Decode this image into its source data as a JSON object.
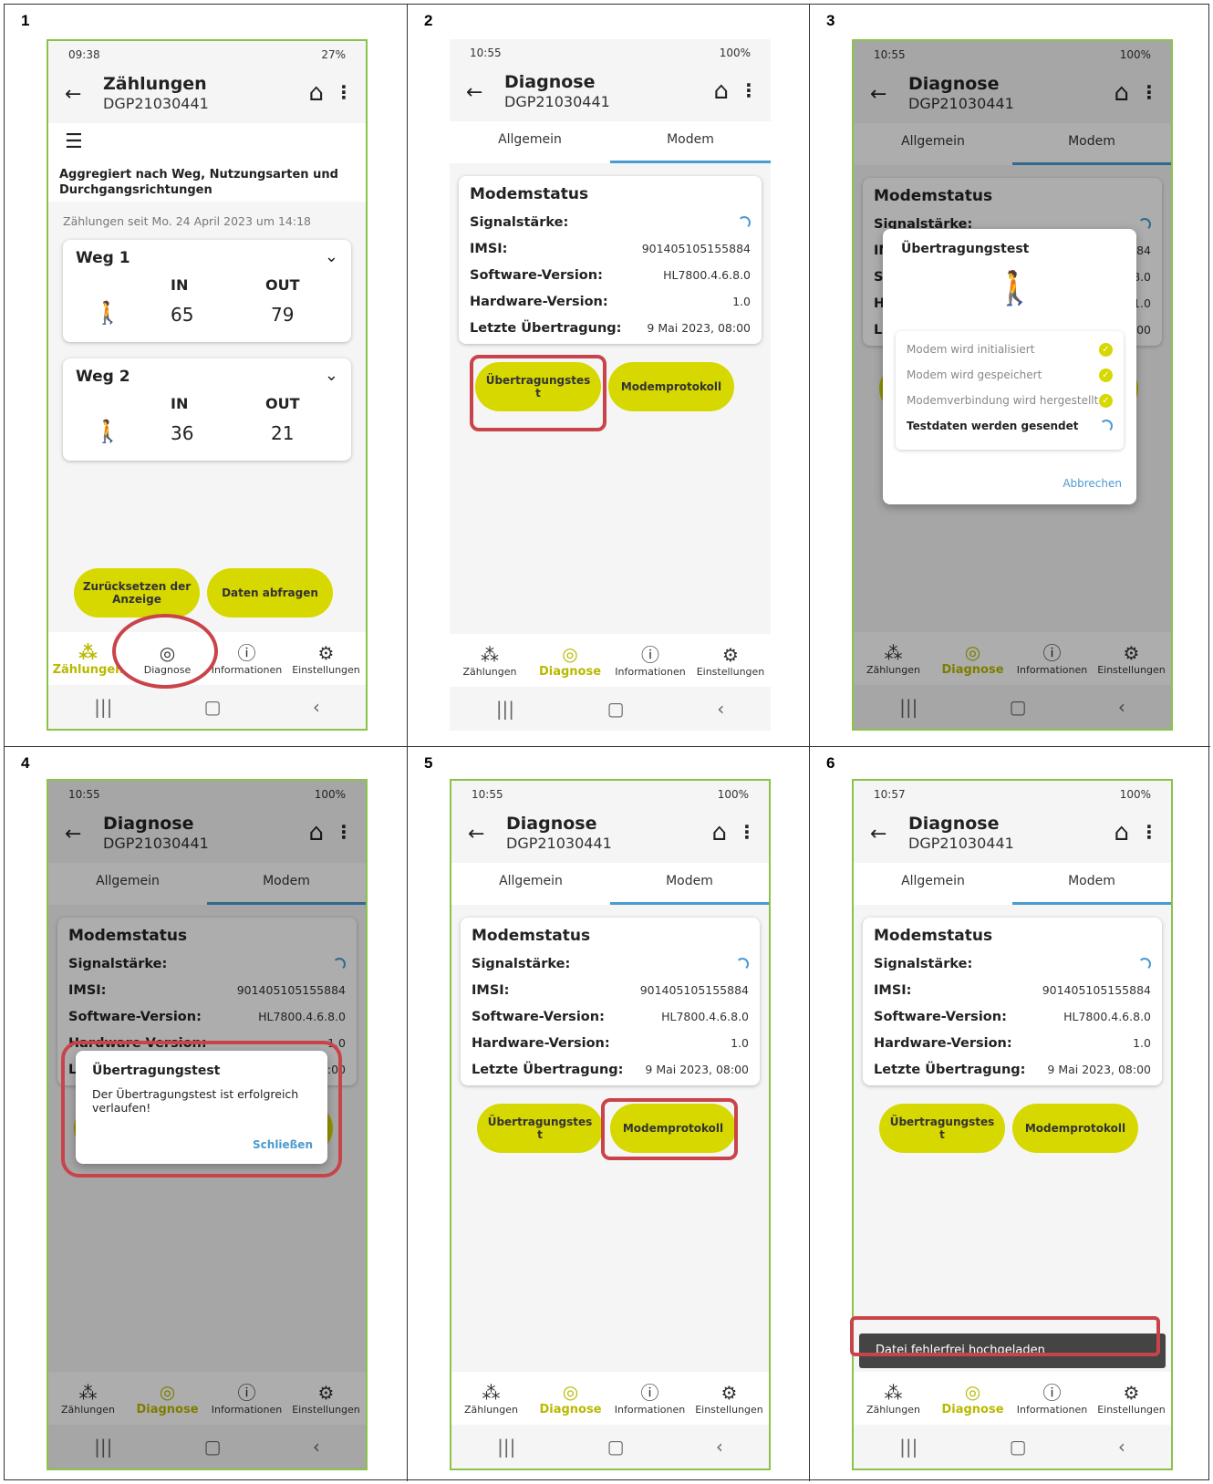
{
  "panels": [
    {
      "number": "1",
      "time": "09:38",
      "status_right": "27%",
      "title": "Zählungen",
      "serial": "DGP21030441",
      "aggregation": "Aggregiert nach Weg, Nutzungsarten und Durchgangsrichtungen",
      "since": "Zählungen seit Mo. 24 April 2023 um 14:18",
      "ways": [
        {
          "name": "Weg 1",
          "in_label": "IN",
          "out_label": "OUT",
          "in": "65",
          "out": "79"
        },
        {
          "name": "Weg 2",
          "in_label": "IN",
          "out_label": "OUT",
          "in": "36",
          "out": "21"
        }
      ],
      "btn_reset": "Zurücksetzen der Anzeige",
      "btn_query": "Daten abfragen"
    },
    {
      "number": "2"
    },
    {
      "number": "3"
    },
    {
      "number": "4"
    },
    {
      "number": "5"
    },
    {
      "number": "6"
    }
  ],
  "common": {
    "time_a": "10:55",
    "time_b": "10:57",
    "battery": "100%",
    "title": "Diagnose",
    "serial": "DGP21030441",
    "tab_general": "Allgemein",
    "tab_modem": "Modem",
    "card_title": "Modemstatus",
    "rows": [
      {
        "k": "Signalstärke:",
        "v": ""
      },
      {
        "k": "IMSI:",
        "v": "901405105155884"
      },
      {
        "k": "Software-Version:",
        "v": "HL7800.4.6.8.0"
      },
      {
        "k": "Hardware-Version:",
        "v": "1.0"
      },
      {
        "k": "Letzte Übertragung:",
        "v": "9 Mai 2023, 08:00"
      }
    ],
    "btn_test": "Übertragungstes t",
    "btn_protocol": "Modemprotokoll",
    "nav": [
      "Zählungen",
      "Diagnose",
      "Informationen",
      "Einstellungen"
    ]
  },
  "dialog_test": {
    "title": "Übertragungstest",
    "steps": [
      "Modem wird initialisiert",
      "Modem wird gespeichert",
      "Modemverbindung wird hergestellt",
      "Testdaten werden gesendet"
    ],
    "cancel": "Abbrechen"
  },
  "dialog_success": {
    "title": "Übertragungstest",
    "message": "Der Übertragungstest ist erfolgreich verlaufen!",
    "close": "Schließen"
  },
  "toast": "Datei fehlerfrei hochgeladen",
  "highlight_color": "#c9444a",
  "accent": "#d6d800"
}
